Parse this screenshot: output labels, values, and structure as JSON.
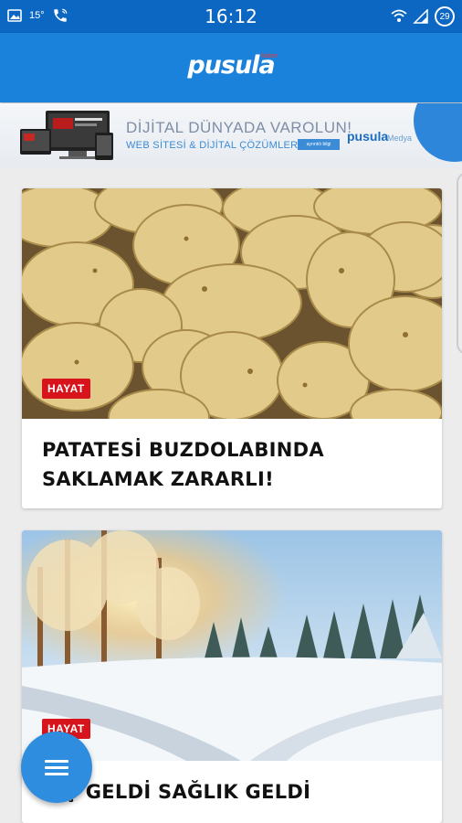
{
  "status_bar": {
    "time": "16:12",
    "temperature": "15°",
    "battery": "29"
  },
  "app_bar": {
    "logo": "pusula",
    "logo_sub": "haber"
  },
  "ad_banner": {
    "headline": "DİJİTAL DÜNYADA VAROLUN!",
    "subline": "WEB SİTESİ & DİJİTAL ÇÖZÜMLER",
    "button": "ayrıntılı bilgi",
    "brand_name": "pusula",
    "brand_sub": "Medya"
  },
  "articles": [
    {
      "category": "HAYAT",
      "title": "PATATESİ BUZDOLABINDA SAKLAMAK ZARARLI!"
    },
    {
      "category": "HAYAT",
      "title": "KIŞ GELDİ SAĞLIK GELDİ"
    }
  ],
  "colors": {
    "status_bar": "#0b67c2",
    "app_bar": "#1b82db",
    "tag": "#d7141b",
    "fab": "#2f8de0"
  }
}
